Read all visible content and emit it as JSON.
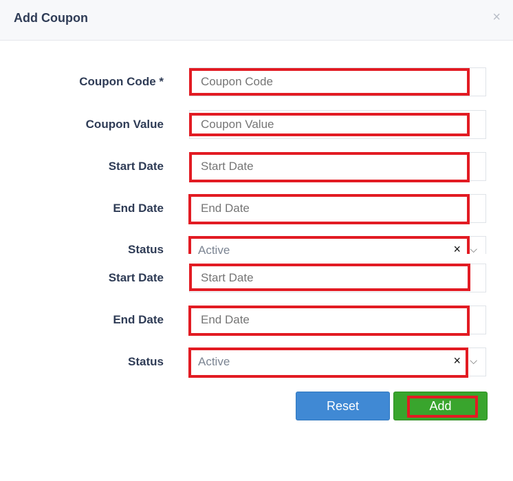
{
  "dialog": {
    "title": "Add Coupon",
    "close_label": "×"
  },
  "fields": {
    "coupon_code": {
      "label": "Coupon Code *",
      "placeholder": "Coupon Code"
    },
    "coupon_value": {
      "label": "Coupon Value",
      "placeholder": "Coupon Value"
    },
    "start_date_1": {
      "label": "Start Date",
      "placeholder": "Start Date"
    },
    "end_date_1": {
      "label": "End Date",
      "placeholder": "End Date"
    },
    "status_1": {
      "label": "Status",
      "value": "Active",
      "clear": "×",
      "chevron": "⌵"
    },
    "start_date_2": {
      "label": "Start Date",
      "placeholder": "Start Date"
    },
    "end_date_2": {
      "label": "End Date",
      "placeholder": "End Date"
    },
    "status_2": {
      "label": "Status",
      "value": "Active",
      "clear": "×",
      "chevron": "⌵"
    }
  },
  "buttons": {
    "reset": "Reset",
    "add": "Add"
  }
}
